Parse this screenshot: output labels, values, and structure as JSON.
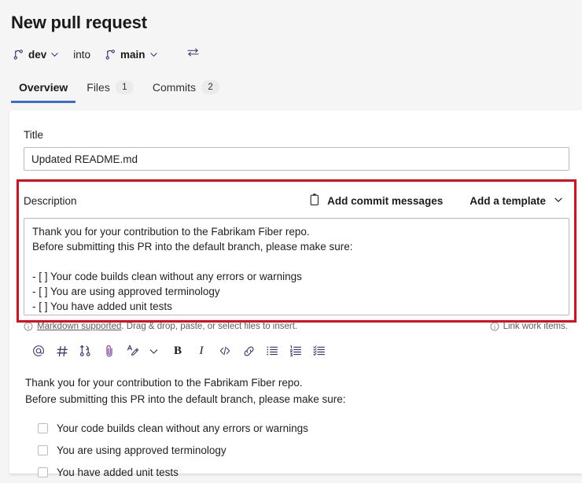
{
  "header": {
    "title": "New pull request",
    "source_branch": "dev",
    "into_label": "into",
    "target_branch": "main",
    "swap_icon": "swap-branches-icon",
    "branch_icon": "branch-icon",
    "chevron_icon": "chevron-down-icon"
  },
  "tabs": [
    {
      "label": "Overview",
      "badge": "",
      "selected": true
    },
    {
      "label": "Files",
      "badge": "1",
      "selected": false
    },
    {
      "label": "Commits",
      "badge": "2",
      "selected": false
    }
  ],
  "form": {
    "title_label": "Title",
    "title_value": "Updated README.md",
    "title_placeholder": "Title",
    "description_label": "Description",
    "add_commit_messages_label": "Add commit messages",
    "add_template_label": "Add a template",
    "description_value": "Thank you for your contribution to the Fabrikam Fiber repo.\nBefore submitting this PR into the default branch, please make sure:\n\n- [ ] Your code builds clean without any errors or warnings\n- [ ] You are using approved terminology\n- [ ] You have added unit tests",
    "description_placeholder": "Description"
  },
  "helper": {
    "markdown_link": "Markdown supported",
    "markdown_rest": ". Drag & drop, paste, or select files to insert.",
    "link_work_items": "Link work items."
  },
  "toolbar": [
    {
      "name": "mention-icon",
      "glyph": "@"
    },
    {
      "name": "hash-tag-icon",
      "glyph": "#"
    },
    {
      "name": "link-pull-request-icon",
      "glyph": ""
    },
    {
      "name": "attachment-icon",
      "glyph": ""
    },
    {
      "name": "highlight-icon",
      "glyph": ""
    },
    {
      "name": "chevron-down-icon",
      "glyph": ""
    },
    {
      "name": "bold-icon",
      "glyph": "B"
    },
    {
      "name": "italic-icon",
      "glyph": "I"
    },
    {
      "name": "code-icon",
      "glyph": "</>"
    },
    {
      "name": "hyperlink-icon",
      "glyph": ""
    },
    {
      "name": "bulleted-list-icon",
      "glyph": ""
    },
    {
      "name": "numbered-list-icon",
      "glyph": ""
    },
    {
      "name": "task-list-icon",
      "glyph": ""
    }
  ],
  "preview": {
    "paragraph_lines": [
      "Thank you for your contribution to the Fabrikam Fiber repo.",
      "Before submitting this PR into the default branch, please make sure:"
    ],
    "tasks": [
      {
        "label": "Your code builds clean without any errors or warnings",
        "checked": false
      },
      {
        "label": "You are using approved terminology",
        "checked": false
      },
      {
        "label": "You have added unit tests",
        "checked": false
      }
    ]
  },
  "annotation": {
    "name": "red-highlight-box",
    "color": "#e00b1c"
  },
  "colors": {
    "page_background": "#f5f5f5",
    "card_background": "#ffffff",
    "accent": "#3a6dc7",
    "text": "#201f1e",
    "muted_text": "#605e5c",
    "icon_purple": "#3b2e6e",
    "annotation_red": "#e00b1c"
  }
}
